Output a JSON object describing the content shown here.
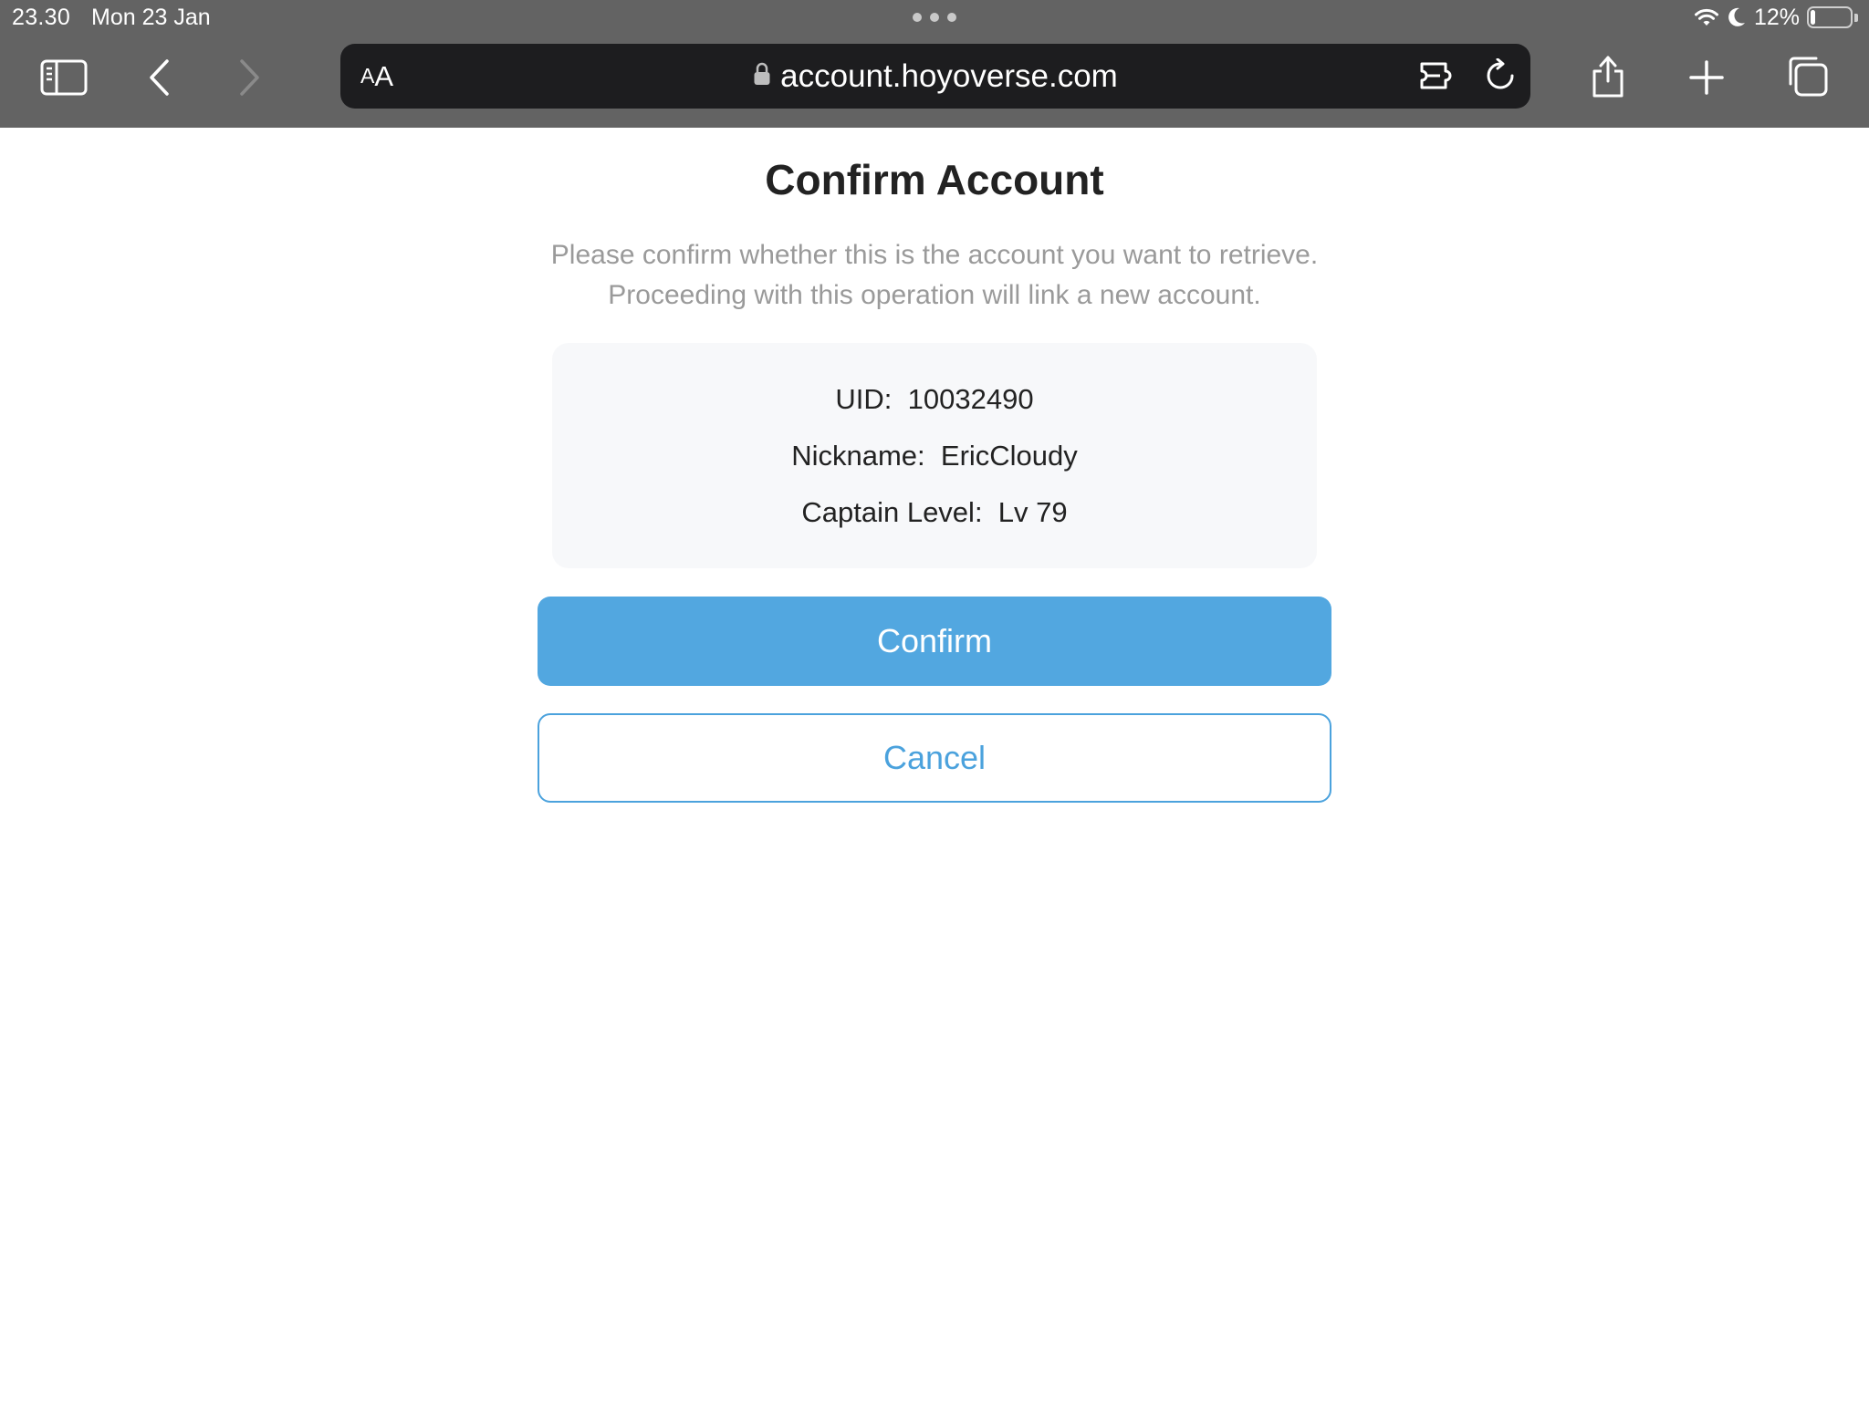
{
  "status_bar": {
    "time": "23.30",
    "date": "Mon 23 Jan",
    "battery_percent": "12%",
    "battery_level": 0.12
  },
  "browser": {
    "aa_small": "A",
    "aa_big": "A",
    "url": "account.hoyoverse.com"
  },
  "page": {
    "title": "Confirm Account",
    "description_line1": "Please confirm whether this is the account you want to retrieve.",
    "description_line2": "Proceeding with this operation will link a new account.",
    "account_info": [
      {
        "label": "UID",
        "separator": ":",
        "value": "10032490"
      },
      {
        "label": "Nickname",
        "separator": ":",
        "value": "EricCloudy"
      },
      {
        "label": "Captain Level",
        "separator": ":",
        "value": "Lv 79"
      }
    ],
    "confirm_label": "Confirm",
    "cancel_label": "Cancel"
  },
  "colors": {
    "toolbar_bg": "#636363",
    "addressbar_bg": "#1d1d1f",
    "accent": "#52a7e0",
    "card_bg": "#f7f8fa"
  }
}
